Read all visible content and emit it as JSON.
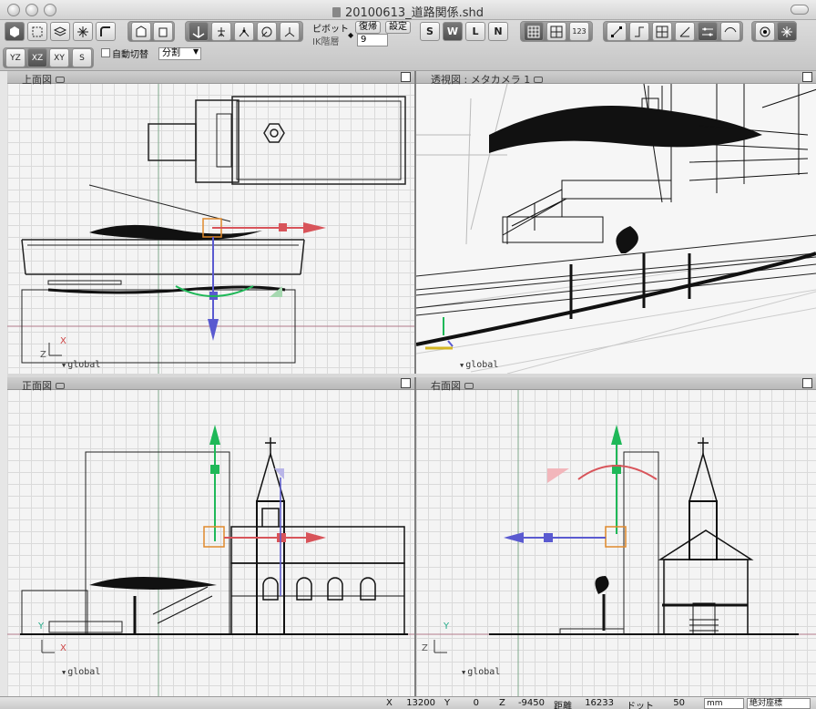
{
  "window": {
    "title": "20100613_道路関係.shd"
  },
  "toolbar": {
    "pivot_label": "ピボット",
    "restore_label": "復帰",
    "settings_label": "設定",
    "ik_label": "IK階層",
    "ik_value": "9",
    "auto_switch_label": "自動切替",
    "split_value": "分割",
    "plane_yz": "YZ",
    "plane_xz": "XZ",
    "plane_xy": "XY",
    "plane_s": "S",
    "mode_s": "S",
    "mode_w": "W",
    "mode_l": "L",
    "mode_n": "N",
    "num_label": "123"
  },
  "viewports": {
    "top": {
      "title": "上面図",
      "space": "global",
      "axis_x": "X",
      "axis_z": "Z"
    },
    "perspective": {
      "title": "透視図 : メタカメラ 1",
      "space": "global"
    },
    "front": {
      "title": "正面図",
      "space": "global",
      "axis_x": "X",
      "axis_y": "Y"
    },
    "right": {
      "title": "右面図",
      "space": "global",
      "axis_z": "Z",
      "axis_y": "Y"
    }
  },
  "status": {
    "x_label": "X",
    "x_value": "13200",
    "y_label": "Y",
    "y_value": "0",
    "z_label": "Z",
    "z_value": "-9450",
    "distance_label": "距離",
    "distance_value": "16233",
    "dot_label": "ドット",
    "dot_value": "50",
    "unit_value": "mm",
    "coord_mode_value": "絶対座標"
  },
  "colors": {
    "axis_red": "#d8545a",
    "axis_green": "#1fb858",
    "axis_blue": "#5a5ad0",
    "handle_orange": "#e08a2c"
  }
}
